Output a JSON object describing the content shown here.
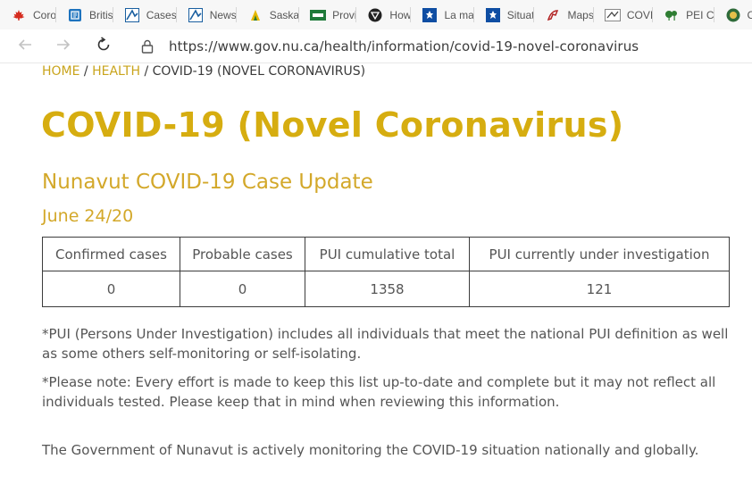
{
  "bookmarks": [
    {
      "label": "Coro",
      "icon": "canada-flag-icon",
      "color": "#d52b1e"
    },
    {
      "label": "Britis",
      "icon": "bc-icon",
      "color": "#1e73be"
    },
    {
      "label": "Cases",
      "icon": "alberta-icon",
      "color": "#1a5fa0"
    },
    {
      "label": "News",
      "icon": "alberta-icon",
      "color": "#1a5fa0"
    },
    {
      "label": "Saska",
      "icon": "saskatchewan-icon",
      "color": "#e6b800"
    },
    {
      "label": "Provi",
      "icon": "manitoba-icon",
      "color": "#1f7a3a"
    },
    {
      "label": "How",
      "icon": "ontario-icon",
      "color": "#222222"
    },
    {
      "label": "La ma",
      "icon": "quebec-icon",
      "color": "#0f4ea3"
    },
    {
      "label": "Situat",
      "icon": "quebec-icon",
      "color": "#0f4ea3"
    },
    {
      "label": "Maps",
      "icon": "new-brunswick-icon",
      "color": "#b22222"
    },
    {
      "label": "COVI",
      "icon": "nova-scotia-icon",
      "color": "#444444"
    },
    {
      "label": "PEI C",
      "icon": "pei-icon",
      "color": "#2e7d32"
    },
    {
      "label": "Co",
      "icon": "newfoundland-icon",
      "color": "#2f6b3a"
    }
  ],
  "navigation": {
    "url": "https://www.gov.nu.ca/health/information/covid-19-novel-coronavirus"
  },
  "breadcrumb": {
    "home": "HOME",
    "health": "HEALTH",
    "current": "COVID-19 (NOVEL CORONAVIRUS)",
    "separator": " / "
  },
  "page": {
    "title": "COVID-19 (Novel Coronavirus)",
    "subtitle": "Nunavut COVID-19 Case Update",
    "date": "June 24/20"
  },
  "table": {
    "headers": [
      "Confirmed cases",
      "Probable cases",
      "PUI cumulative total",
      "PUI currently under investigation"
    ],
    "rows": [
      [
        "0",
        "0",
        "1358",
        "121"
      ]
    ]
  },
  "notes": [
    "*PUI (Persons Under Investigation) includes all individuals that meet the national PUI definition as well as some others self-monitoring or self-isolating.",
    "*Please note: Every effort is made to keep this list up-to-date and complete but it may not reflect all individuals tested. Please keep that in mind when reviewing this information.",
    "The Government of Nunavut is actively monitoring the COVID-19 situation nationally and globally."
  ],
  "colors": {
    "accent_gold": "#d6ad10",
    "subtitle_gold": "#d3a82a",
    "link_gold": "#c9a41c",
    "text_gray": "#555555"
  }
}
